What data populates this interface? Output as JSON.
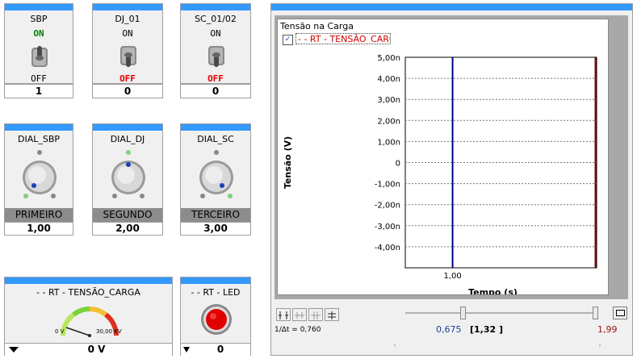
{
  "switches": [
    {
      "title": "SBP",
      "on_label": "ON",
      "off_label": "OFF",
      "value": "1",
      "state": "on"
    },
    {
      "title": "DJ_01",
      "on_label": "ON",
      "off_label": "OFF",
      "value": "0",
      "state": "off"
    },
    {
      "title": "SC_01/02",
      "on_label": "ON",
      "off_label": "OFF",
      "value": "0",
      "state": "off"
    }
  ],
  "dials": [
    {
      "title": "DIAL_SBP",
      "label": "PRIMEIRO",
      "value": "1,00"
    },
    {
      "title": "DIAL_DJ",
      "label": "SEGUNDO",
      "value": "2,00"
    },
    {
      "title": "DIAL_SC",
      "label": "TERCEIRO",
      "value": "3,00"
    }
  ],
  "gauge": {
    "title": "- - RT - TENSÃO_CARGA",
    "min_label": "0 V",
    "max_label": "30,00 KV",
    "value": "0 V"
  },
  "led": {
    "title": "- - RT - LED",
    "value": "0"
  },
  "chart_panel": {
    "title": "Tensão na Carga",
    "legend": "- - RT - TENSÃO_CARGA",
    "legend_checked": true,
    "delta_label": "1/Δt = 0,760",
    "cursor_left": "0,675",
    "cursor_mid": "[1,32 ]",
    "cursor_right": "1,99"
  },
  "colors": {
    "accent": "#3399ff",
    "on": "#008000",
    "off": "#e00000",
    "trace_blue": "#00008b",
    "trace_red": "#8b0000",
    "cursor_blue": "#1a3fa0",
    "cursor_red": "#9a1010"
  },
  "chart_data": {
    "type": "line",
    "title": "Tensão na Carga",
    "xlabel": "Tempo (s)",
    "ylabel": "Tensão (V)",
    "yticks": [
      "5,00n",
      "4,00n",
      "3,00n",
      "2,00n",
      "1,00n",
      "0",
      "-1,00n",
      "-2,00n",
      "-3,00n",
      "-4,00n"
    ],
    "xticks": [
      "1,00"
    ],
    "ylim": [
      -5e-09,
      5e-09
    ],
    "xlim": [
      0.675,
      1.99
    ],
    "grid": true,
    "series": [
      {
        "name": "- - RT - TENSÃO_CARGA",
        "values": []
      }
    ],
    "cursors": [
      {
        "x": 1.0,
        "color": "#00008b"
      },
      {
        "x": 1.99,
        "color": "#8b0000"
      }
    ]
  }
}
